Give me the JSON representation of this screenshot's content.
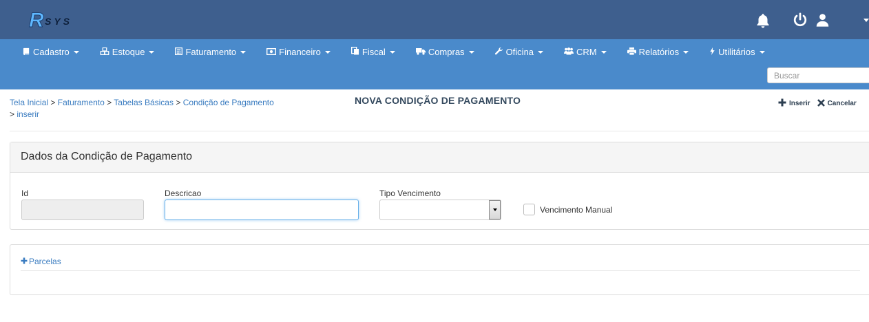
{
  "header": {
    "logo_text": "RSYS",
    "icons": [
      "bell-icon",
      "power-icon",
      "user-icon"
    ]
  },
  "menu": [
    {
      "label": "Cadastro",
      "icon": "book-icon"
    },
    {
      "label": "Estoque",
      "icon": "cubes-icon"
    },
    {
      "label": "Faturamento",
      "icon": "calculator-icon"
    },
    {
      "label": "Financeiro",
      "icon": "money-icon"
    },
    {
      "label": "Fiscal",
      "icon": "files-icon"
    },
    {
      "label": "Compras",
      "icon": "truck-icon"
    },
    {
      "label": "Oficina",
      "icon": "wrench-icon"
    },
    {
      "label": "CRM",
      "icon": "users-icon"
    },
    {
      "label": "Relatórios",
      "icon": "print-icon"
    },
    {
      "label": "Utilitários",
      "icon": "bolt-icon"
    }
  ],
  "search": {
    "placeholder": "Buscar",
    "value": ""
  },
  "breadcrumb": {
    "items": [
      "Tela Inicial",
      "Faturamento",
      "Tabelas Básicas",
      "Condição de Pagamento",
      "inserir"
    ],
    "separator": ">"
  },
  "page": {
    "title": "NOVA CONDIÇÃO DE PAGAMENTO"
  },
  "actions": {
    "insert_label": "Inserir",
    "cancel_label": "Cancelar"
  },
  "form": {
    "panel_title": "Dados da Condição de Pagamento",
    "id_label": "Id",
    "id_value": "",
    "descricao_label": "Descricao",
    "descricao_value": "",
    "tipo_vencimento_label": "Tipo Vencimento",
    "tipo_vencimento_value": "",
    "vencimento_manual_label": "Vencimento Manual",
    "vencimento_manual_checked": false
  },
  "parcelas": {
    "label": "Parcelas"
  },
  "colors": {
    "topbar": "#3e5f8e",
    "navbar": "#4a8acb",
    "link": "#3a7cc0"
  }
}
